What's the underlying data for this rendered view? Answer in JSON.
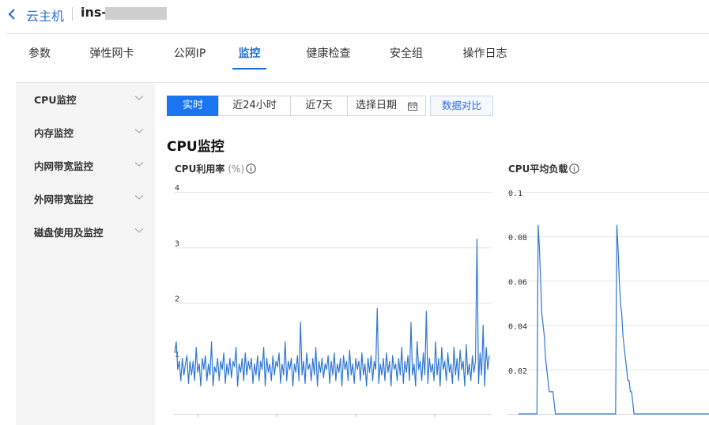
{
  "header": {
    "back_icon": "chevron-left-icon",
    "breadcrumb_link": "云主机",
    "instance_name": "ins-"
  },
  "tabs": [
    {
      "label": "参数",
      "active": false
    },
    {
      "label": "弹性网卡",
      "active": false
    },
    {
      "label": "公网IP",
      "active": false
    },
    {
      "label": "监控",
      "active": true
    },
    {
      "label": "健康检查",
      "active": false
    },
    {
      "label": "安全组",
      "active": false
    },
    {
      "label": "操作日志",
      "active": false
    }
  ],
  "sidebar": {
    "items": [
      {
        "label": "CPU监控",
        "icon": "chevron-down-icon"
      },
      {
        "label": "内存监控",
        "icon": "chevron-down-icon"
      },
      {
        "label": "内网带宽监控",
        "icon": "chevron-down-icon"
      },
      {
        "label": "外网带宽监控",
        "icon": "chevron-down-icon"
      },
      {
        "label": "磁盘使用及监控",
        "icon": "chevron-down-icon"
      }
    ]
  },
  "time_range": {
    "buttons": [
      "实时",
      "近24小时",
      "近7天"
    ],
    "selected": "实时",
    "date_picker_label": "选择日期",
    "date_picker_icon": "calendar-icon",
    "compare_label": "数据对比"
  },
  "section_title": "CPU监控",
  "colors": {
    "accent": "#1a75f0",
    "line": "#2f77d4",
    "link": "#2f6fd6"
  },
  "chart_data": [
    {
      "type": "line",
      "title": "CPU利用率",
      "unit": "(%)",
      "info_icon": "info-icon",
      "yticks": [
        "4",
        "3",
        "2",
        "1"
      ],
      "ylim": [
        0,
        4
      ],
      "grid": true,
      "values": [
        1.1,
        1.3,
        0.8,
        0.95,
        0.6,
        1.0,
        0.7,
        0.9,
        1.05,
        0.55,
        0.95,
        0.7,
        0.95,
        0.6,
        1.2,
        0.75,
        0.9,
        0.5,
        1.0,
        0.8,
        1.05,
        0.6,
        0.9,
        0.7,
        1.3,
        0.5,
        0.85,
        0.75,
        1.0,
        0.6,
        0.95,
        0.8,
        1.1,
        0.55,
        0.9,
        0.7,
        1.0,
        0.65,
        0.95,
        0.85,
        1.2,
        0.5,
        0.9,
        0.75,
        1.0,
        0.6,
        1.1,
        0.7,
        0.95,
        0.8,
        1.0,
        0.55,
        0.9,
        0.7,
        1.05,
        0.6,
        0.95,
        0.8,
        1.2,
        0.5,
        1.0,
        0.75,
        0.9,
        0.6,
        1.05,
        0.7,
        0.95,
        0.85,
        1.1,
        0.55,
        0.9,
        0.7,
        1.3,
        0.6,
        0.95,
        0.8,
        1.0,
        0.5,
        0.9,
        0.75,
        1.05,
        0.6,
        1.65,
        0.7,
        0.95,
        0.55,
        1.1,
        0.8,
        0.9,
        0.6,
        1.0,
        0.7,
        1.2,
        0.5,
        0.95,
        0.75,
        1.0,
        0.65,
        0.9,
        0.8,
        1.05,
        0.55,
        0.95,
        0.7,
        1.1,
        0.6,
        0.9,
        0.75,
        1.0,
        0.5,
        1.05,
        0.8,
        0.95,
        0.6,
        1.15,
        0.7,
        0.9,
        0.55,
        1.0,
        0.8,
        0.95,
        0.6,
        1.1,
        0.7,
        0.9,
        0.5,
        1.0,
        0.75,
        1.05,
        0.6,
        0.95,
        0.8,
        1.9,
        0.55,
        0.9,
        0.7,
        1.0,
        0.6,
        1.1,
        0.75,
        0.95,
        0.5,
        1.05,
        0.8,
        0.9,
        0.6,
        1.0,
        0.7,
        1.2,
        0.55,
        0.95,
        0.75,
        1.05,
        0.6,
        1.65,
        0.7,
        0.9,
        0.5,
        1.3,
        0.8,
        0.95,
        0.6,
        1.1,
        0.7,
        1.85,
        0.55,
        1.0,
        0.75,
        0.9,
        0.6,
        1.3,
        0.7,
        1.0,
        0.5,
        1.2,
        0.8,
        0.95,
        0.6,
        1.1,
        0.75,
        0.9,
        0.55,
        1.2,
        0.7,
        1.0,
        0.6,
        1.15,
        0.8,
        0.95,
        0.5,
        1.25,
        0.7,
        0.9,
        0.6,
        1.05,
        0.75,
        0.95,
        3.15,
        0.55,
        1.1,
        0.7,
        1.6,
        0.5,
        1.2,
        0.8,
        1.05
      ]
    },
    {
      "type": "line",
      "title": "CPU平均负载",
      "info_icon": "info-icon",
      "yticks": [
        "0.1",
        "0.08",
        "0.06",
        "0.04",
        "0.02"
      ],
      "ylim": [
        0,
        0.1
      ],
      "grid": true,
      "values": [
        0.0,
        0.0,
        0.0,
        0.0,
        0.0,
        0.0,
        0.0,
        0.0,
        0.0,
        0.0,
        0.0,
        0.0,
        0.0,
        0.0,
        0.0,
        0.0,
        0.085,
        0.075,
        0.06,
        0.045,
        0.04,
        0.035,
        0.025,
        0.02,
        0.015,
        0.01,
        0.01,
        0.01,
        0.01,
        0.005,
        0.0,
        0.0,
        0.0,
        0.0,
        0.0,
        0.0,
        0.0,
        0.0,
        0.0,
        0.0,
        0.0,
        0.0,
        0.0,
        0.0,
        0.0,
        0.0,
        0.0,
        0.0,
        0.0,
        0.0,
        0.0,
        0.0,
        0.0,
        0.0,
        0.0,
        0.0,
        0.0,
        0.0,
        0.0,
        0.0,
        0.0,
        0.0,
        0.0,
        0.0,
        0.0,
        0.0,
        0.0,
        0.0,
        0.0,
        0.0,
        0.0,
        0.0,
        0.0,
        0.0,
        0.0,
        0.0,
        0.0,
        0.0,
        0.0,
        0.0,
        0.085,
        0.075,
        0.06,
        0.05,
        0.045,
        0.035,
        0.03,
        0.025,
        0.02,
        0.015,
        0.015,
        0.01,
        0.01,
        0.005,
        0.0,
        0.0,
        0.0,
        0.0,
        0.0,
        0.0,
        0.0,
        0.0,
        0.0,
        0.0,
        0.0,
        0.0,
        0.0,
        0.0,
        0.0,
        0.0,
        0.0,
        0.0,
        0.0,
        0.0,
        0.0,
        0.0,
        0.0,
        0.0,
        0.0,
        0.0,
        0.0,
        0.0,
        0.0,
        0.0,
        0.0,
        0.0,
        0.0,
        0.0,
        0.0,
        0.0,
        0.0,
        0.0,
        0.0,
        0.0,
        0.0,
        0.0,
        0.0,
        0.0,
        0.0,
        0.0,
        0.0,
        0.0,
        0.0,
        0.0,
        0.0,
        0.0,
        0.0,
        0.0,
        0.0,
        0.0,
        0.0,
        0.0,
        0.0,
        0.0,
        0.0,
        0.0
      ]
    }
  ]
}
